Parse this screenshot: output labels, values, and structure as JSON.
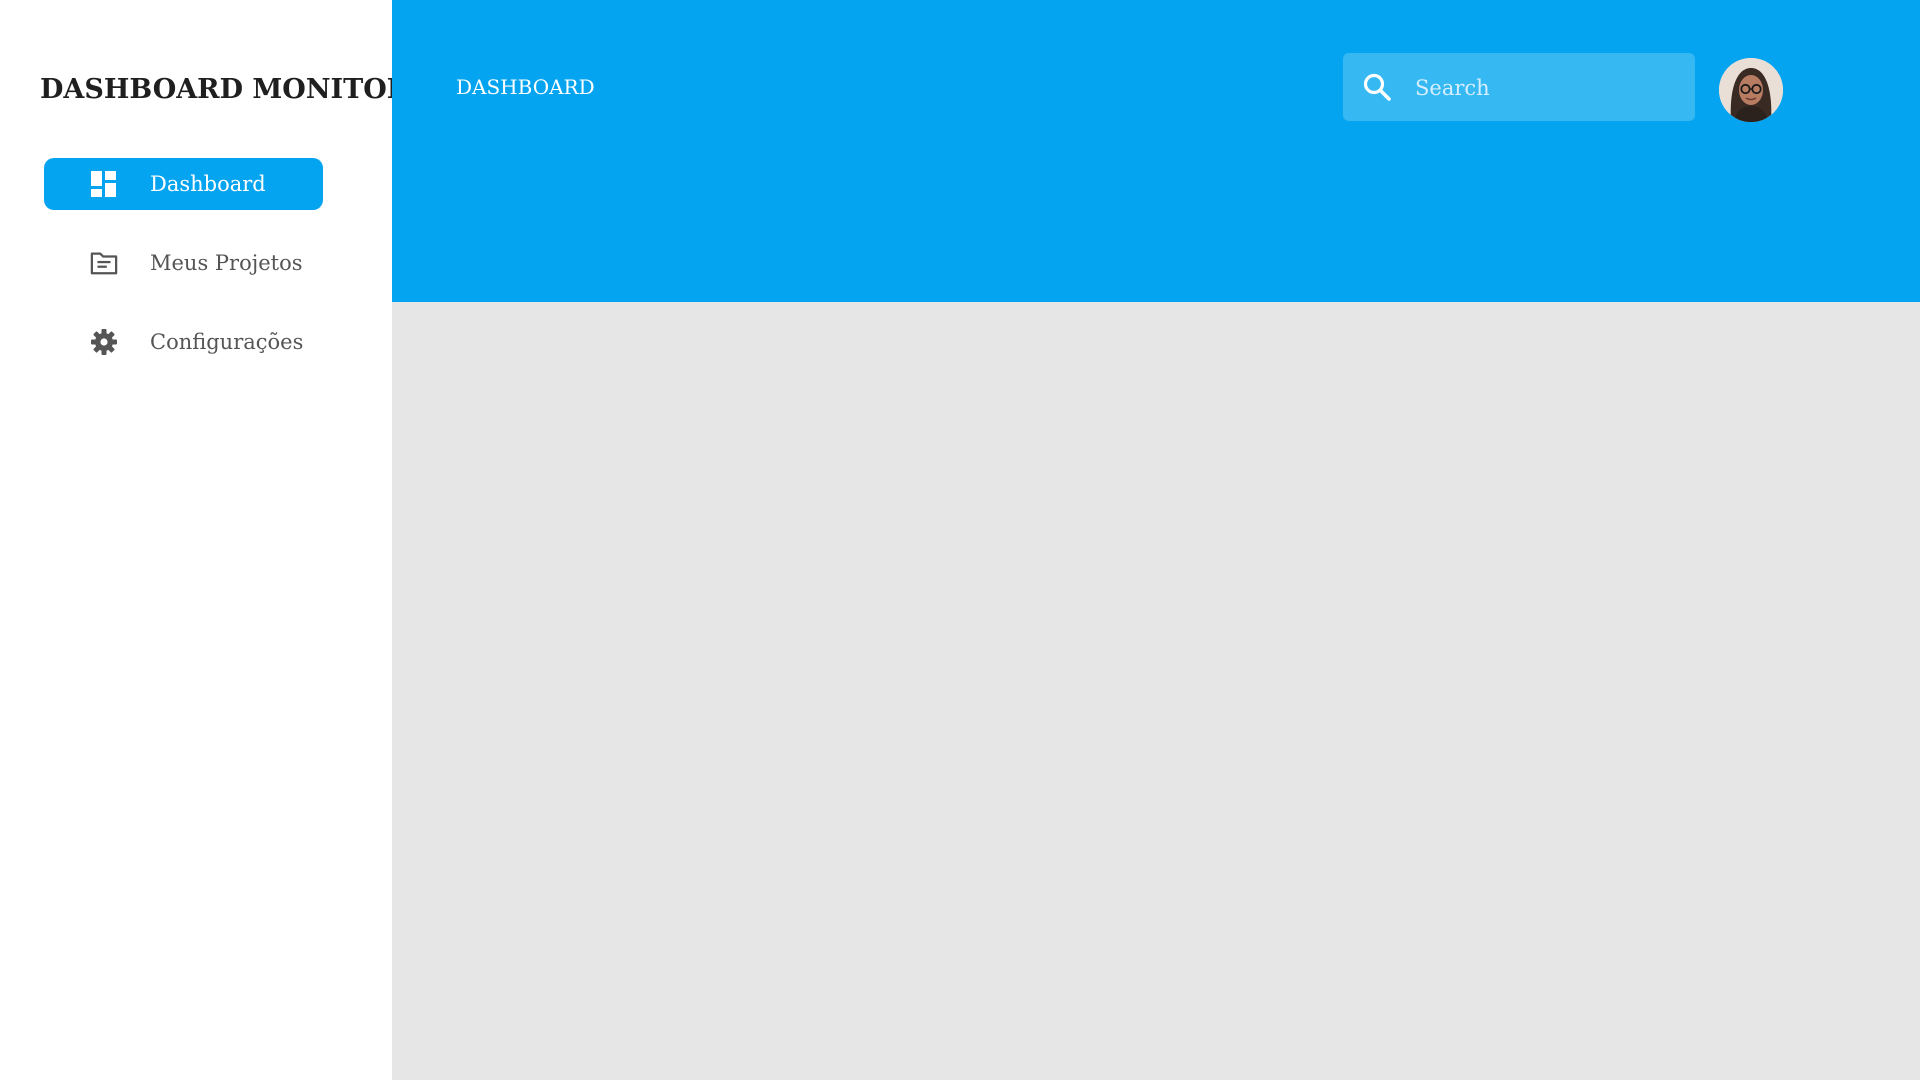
{
  "sidebar": {
    "app_title": "DASHBOARD MONITOR",
    "items": [
      {
        "label": "Dashboard",
        "icon": "dashboard-icon",
        "active": true
      },
      {
        "label": "Meus Projetos",
        "icon": "folder-icon",
        "active": false
      },
      {
        "label": "Configurações",
        "icon": "gear-icon",
        "active": false
      }
    ]
  },
  "header": {
    "page_title": "DASHBOARD",
    "search": {
      "placeholder": "Search",
      "value": "",
      "icon": "search-icon"
    },
    "avatar": {
      "icon": "user-avatar"
    }
  },
  "colors": {
    "accent": "#05a4f0",
    "search_bg": "#36b8f3",
    "content_bg": "#e6e6e6",
    "sidebar_bg": "#ffffff",
    "title_text": "#1f1f1f",
    "nav_text": "#555555"
  }
}
